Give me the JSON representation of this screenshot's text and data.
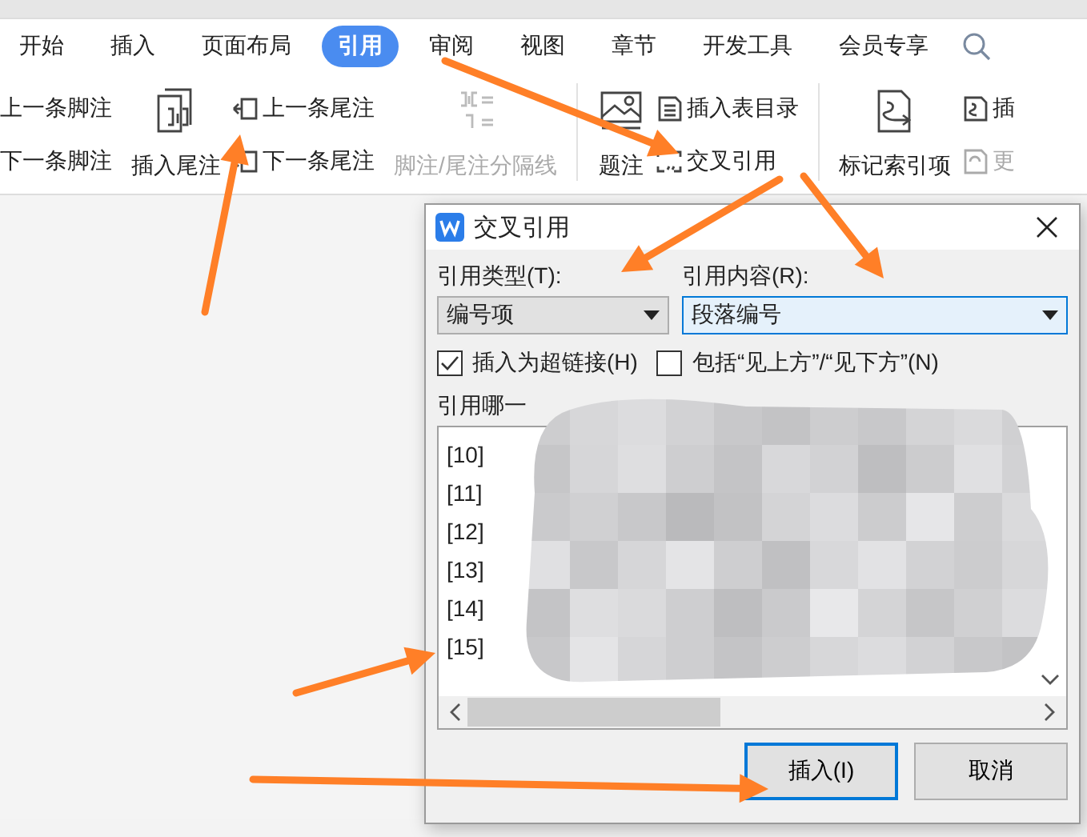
{
  "ribbon": {
    "tabs": [
      {
        "label": "开始",
        "selected": false
      },
      {
        "label": "插入",
        "selected": false
      },
      {
        "label": "页面布局",
        "selected": false
      },
      {
        "label": "引用",
        "selected": true
      },
      {
        "label": "审阅",
        "selected": false
      },
      {
        "label": "视图",
        "selected": false
      },
      {
        "label": "章节",
        "selected": false
      },
      {
        "label": "开发工具",
        "selected": false
      },
      {
        "label": "会员专享",
        "selected": false
      }
    ]
  },
  "toolbar": [
    {
      "kind": "column",
      "items": [
        {
          "label": "上一条脚注",
          "disabled": false
        },
        {
          "label": "下一条脚注",
          "disabled": false
        }
      ]
    },
    {
      "kind": "large",
      "label": "插入尾注",
      "disabled": false
    },
    {
      "kind": "column",
      "items": [
        {
          "label": "上一条尾注",
          "disabled": false
        },
        {
          "label": "下一条尾注",
          "disabled": false
        }
      ]
    },
    {
      "kind": "large",
      "label": "脚注/尾注分隔线",
      "disabled": true
    },
    {
      "kind": "separator"
    },
    {
      "kind": "large",
      "label": "题注",
      "disabled": false
    },
    {
      "kind": "column",
      "items": [
        {
          "label": "插入表目录",
          "disabled": false
        },
        {
          "label": "交叉引用",
          "disabled": false
        }
      ]
    },
    {
      "kind": "separator"
    },
    {
      "kind": "large",
      "label": "标记索引项",
      "disabled": false
    },
    {
      "kind": "column",
      "items": [
        {
          "label": "插",
          "disabled": false
        },
        {
          "label": "更",
          "disabled": true
        }
      ]
    }
  ],
  "dialog": {
    "title": "交叉引用",
    "type_label": "引用类型(T):",
    "type_value": "编号项",
    "content_label": "引用内容(R):",
    "content_value": "段落编号",
    "checkboxes": [
      {
        "label": "插入为超链接(H)",
        "checked": true
      },
      {
        "label": "包括“见上方”/“见下方”(N)",
        "checked": false
      }
    ],
    "list_label": "引用哪一",
    "list_items": [
      "[10]",
      "[11]",
      "[12]",
      "[13]",
      "[14]",
      "[15]"
    ],
    "buttons": [
      {
        "label": "插入(I)",
        "selected": true
      },
      {
        "label": "取消",
        "selected": false
      }
    ]
  }
}
